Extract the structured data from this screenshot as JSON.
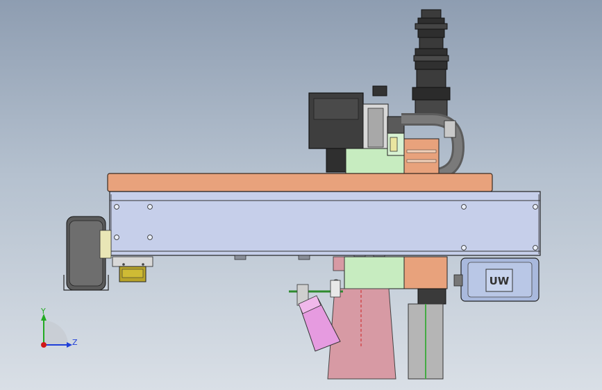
{
  "triad": {
    "y_label": "Y",
    "z_label": "Z",
    "colors": {
      "y": "#22aa22",
      "z": "#1f3fd8",
      "x": "#d01818"
    }
  },
  "motor_badge": {
    "text": "UW"
  },
  "colors": {
    "plate": "#e8a27c",
    "rail": "#c6cfea",
    "green_bracket": "#c7ecc0",
    "nozzle": "#d79aa4",
    "tool_pink": "#e69be0",
    "dark_body": "#3e3e3e",
    "motor_blue": "#a9b9dd"
  }
}
